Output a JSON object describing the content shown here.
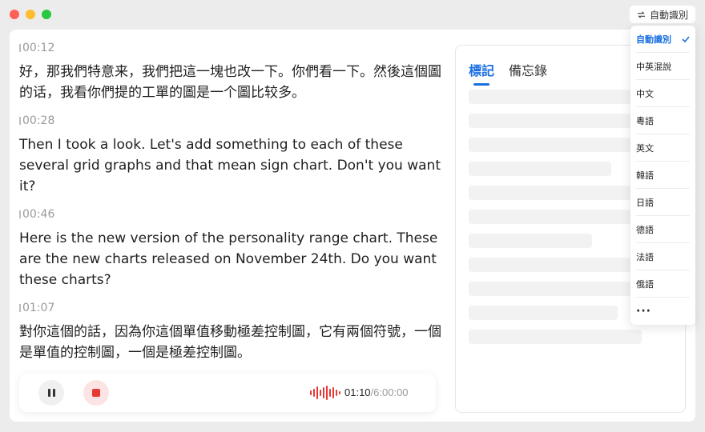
{
  "header": {
    "lang_toggle_label": "自動識別"
  },
  "transcript": [
    {
      "time": "00:12",
      "text": "好，那我們特意来，我們把這一塊也改一下。你們看一下。然後這個圖的话，我看你們提的工單的圖是一个圖比较多。"
    },
    {
      "time": "00:28",
      "text": "Then I took a look. Let's add something to each of these several grid graphs and that mean sign chart. Don't you want it?"
    },
    {
      "time": "00:46",
      "text": "Here is the new version of the personality range chart. These are the new charts released on November 24th. Do you want these charts?"
    },
    {
      "time": "01:07",
      "text": "對你這個的話，因為你這個單值移動極差控制圖，它有兩個符號，一個是單值的控制圖，一個是極差控制圖。"
    }
  ],
  "player": {
    "current_time": "01:10",
    "total_time": "/6:00:00",
    "pause_icon": "pause-icon",
    "stop_icon": "stop-icon",
    "wave_icon": "audio-wave-icon"
  },
  "side_panel": {
    "tabs": [
      {
        "label": "標記",
        "active": true
      },
      {
        "label": "備忘錄",
        "active": false
      }
    ]
  },
  "language_menu": {
    "items": [
      {
        "label": "自動識別",
        "selected": true
      },
      {
        "label": "中英混說",
        "selected": false
      },
      {
        "label": "中文",
        "selected": false
      },
      {
        "label": "粵語",
        "selected": false
      },
      {
        "label": "英文",
        "selected": false
      },
      {
        "label": "韓語",
        "selected": false
      },
      {
        "label": "日語",
        "selected": false
      },
      {
        "label": "德語",
        "selected": false
      },
      {
        "label": "法語",
        "selected": false
      },
      {
        "label": "俄語",
        "selected": false
      },
      {
        "label": "···",
        "selected": false
      }
    ]
  },
  "colors": {
    "accent": "#1a6fe0",
    "record_red": "#e53935",
    "window_bg": "#ececec"
  }
}
